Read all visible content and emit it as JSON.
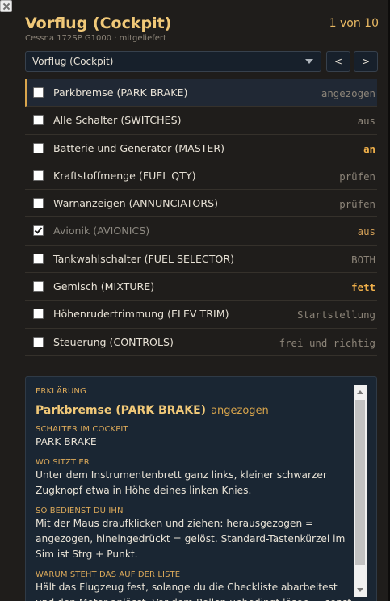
{
  "header": {
    "title": "Vorflug (Cockpit)",
    "subtitle": "Cessna 172SP G1000 · mitgeliefert",
    "counter": "1 von 10"
  },
  "nav": {
    "select_value": "Vorflug (Cockpit)",
    "prev_label": "<",
    "next_label": ">"
  },
  "checklist": [
    {
      "label": "Parkbremse (PARK BRAKE)",
      "value": "angezogen",
      "checked": false,
      "active": true,
      "highlight": false
    },
    {
      "label": "Alle Schalter (SWITCHES)",
      "value": "aus",
      "checked": false,
      "active": false,
      "highlight": false
    },
    {
      "label": "Batterie und Generator (MASTER)",
      "value": "an",
      "checked": false,
      "active": false,
      "highlight": true
    },
    {
      "label": "Kraftstoffmenge (FUEL QTY)",
      "value": "prüfen",
      "checked": false,
      "active": false,
      "highlight": false
    },
    {
      "label": "Warnanzeigen (ANNUNCIATORS)",
      "value": "prüfen",
      "checked": false,
      "active": false,
      "highlight": false
    },
    {
      "label": "Avionik (AVIONICS)",
      "value": "aus",
      "checked": true,
      "active": false,
      "highlight": false
    },
    {
      "label": "Tankwahlschalter (FUEL SELECTOR)",
      "value": "BOTH",
      "checked": false,
      "active": false,
      "highlight": false
    },
    {
      "label": "Gemisch (MIXTURE)",
      "value": "fett",
      "checked": false,
      "active": false,
      "highlight": true
    },
    {
      "label": "Höhenrudertrimmung (ELEV TRIM)",
      "value": "Startstellung",
      "checked": false,
      "active": false,
      "highlight": false
    },
    {
      "label": "Steuerung (CONTROLS)",
      "value": "frei und richtig",
      "checked": false,
      "active": false,
      "highlight": false
    }
  ],
  "explanation": {
    "caption": "ERKLÄRUNG",
    "title": "Parkbremse (PARK BRAKE)",
    "state": "angezogen",
    "sections": [
      {
        "caption": "SCHALTER IM COCKPIT",
        "text": "PARK BRAKE"
      },
      {
        "caption": "WO SITZT ER",
        "text": "Unter dem Instrumentenbrett ganz links, kleiner schwarzer Zugknopf etwa in Höhe deines linken Knies."
      },
      {
        "caption": "SO BEDIENST DU IHN",
        "text": "Mit der Maus draufklicken und ziehen: herausgezogen = angezogen, hineingedrückt = gelöst. Standard-Tastenkürzel im Sim ist Strg + Punkt."
      },
      {
        "caption": "WARUM STEHT DAS AUF DER LISTE",
        "text": "Hält das Flugzeug fest, solange du die Checkliste abarbeitest und den Motor anlässt. Vor dem Rollen unbedingt lösen — sonst"
      }
    ]
  },
  "colors": {
    "accent": "#f0c878",
    "highlight_value": "#f0b04a",
    "background": "#1f1d1b",
    "panel": "#1a2633"
  }
}
